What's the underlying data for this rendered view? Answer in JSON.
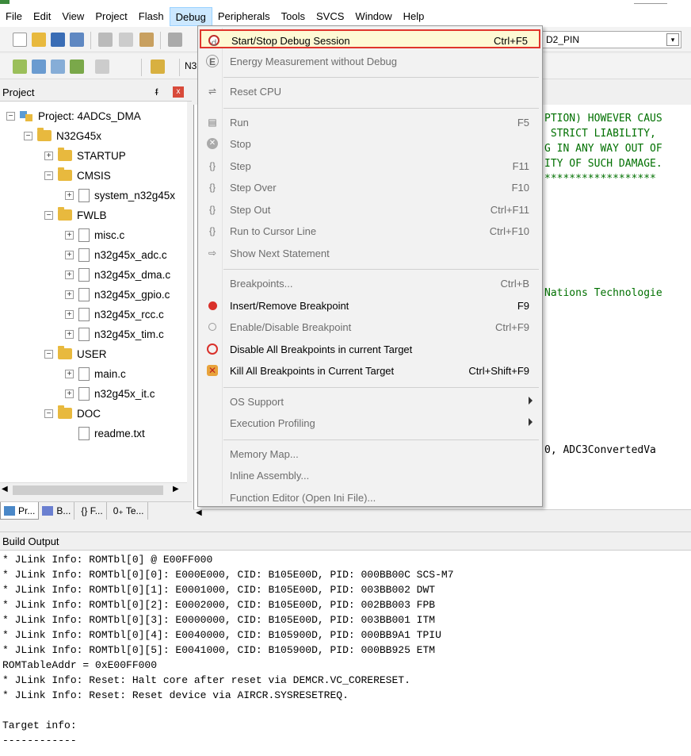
{
  "colors": {
    "highlight_border": "#e0352c",
    "code_green": "#007000",
    "menu_active": "#cce8ff"
  },
  "menubar": [
    "File",
    "Edit",
    "View",
    "Project",
    "Flash",
    "Debug",
    "Peripherals",
    "Tools",
    "SVCS",
    "Window",
    "Help"
  ],
  "toolbar": {
    "target": "D2_PIN",
    "tb2_label": "N3"
  },
  "project_panel": {
    "title": "Project",
    "pin": "ᵮ",
    "close": "x",
    "tree": [
      {
        "label": "Project: 4ADCs_DMA",
        "icon": "project-icon",
        "depth": 0,
        "expander": "−"
      },
      {
        "label": "N32G45x",
        "icon": "folder-icon",
        "depth": 1,
        "expander": "−"
      },
      {
        "label": "STARTUP",
        "icon": "folder-icon",
        "depth": 2,
        "expander": "+"
      },
      {
        "label": "CMSIS",
        "icon": "folder-icon",
        "depth": 2,
        "expander": "−"
      },
      {
        "label": "system_n32g45x",
        "icon": "file-icon",
        "depth": 3,
        "expander": "+"
      },
      {
        "label": "FWLB",
        "icon": "folder-icon",
        "depth": 2,
        "expander": "−"
      },
      {
        "label": "misc.c",
        "icon": "file-icon",
        "depth": 3,
        "expander": "+"
      },
      {
        "label": "n32g45x_adc.c",
        "icon": "file-icon",
        "depth": 3,
        "expander": "+"
      },
      {
        "label": "n32g45x_dma.c",
        "icon": "file-icon",
        "depth": 3,
        "expander": "+"
      },
      {
        "label": "n32g45x_gpio.c",
        "icon": "file-icon",
        "depth": 3,
        "expander": "+"
      },
      {
        "label": "n32g45x_rcc.c",
        "icon": "file-icon",
        "depth": 3,
        "expander": "+"
      },
      {
        "label": "n32g45x_tim.c",
        "icon": "file-icon",
        "depth": 3,
        "expander": "+"
      },
      {
        "label": "USER",
        "icon": "folder-icon",
        "depth": 2,
        "expander": "−"
      },
      {
        "label": "main.c",
        "icon": "file-icon",
        "depth": 3,
        "expander": "+"
      },
      {
        "label": "n32g45x_it.c",
        "icon": "file-icon",
        "depth": 3,
        "expander": "+"
      },
      {
        "label": "DOC",
        "icon": "folder-icon",
        "depth": 2,
        "expander": "−"
      },
      {
        "label": "readme.txt",
        "icon": "file-icon",
        "depth": 3,
        "expander": ""
      }
    ],
    "tabs": [
      "Pr...",
      "B...",
      "{} F...",
      "0₊ Te..."
    ]
  },
  "editor_lines": [
    {
      "text": "PTION) HOWEVER CAUS",
      "color": "green"
    },
    {
      "text": " STRICT LIABILITY,",
      "color": "green"
    },
    {
      "text": "G IN ANY WAY OUT OF",
      "color": "green"
    },
    {
      "text": "ITY OF SUCH DAMAGE.",
      "color": "green"
    },
    {
      "text": "******************",
      "color": "green"
    },
    {
      "text": "Nations Technologie",
      "color": "green"
    },
    {
      "text": "0, ADC3ConvertedVa",
      "color": "black"
    }
  ],
  "debug_menu": [
    {
      "label": "Start/Stop Debug Session",
      "shortcut": "Ctrl+F5",
      "icon": "debug-session-icon",
      "state": "enabled",
      "highlight": true
    },
    {
      "label": "Energy Measurement without Debug",
      "shortcut": "",
      "icon": "energy-icon",
      "state": "disabled"
    },
    {
      "sep": true
    },
    {
      "label": "Reset CPU",
      "shortcut": "",
      "icon": "reset-cpu-icon",
      "state": "disabled"
    },
    {
      "sep": true
    },
    {
      "label": "Run",
      "shortcut": "F5",
      "icon": "run-icon",
      "state": "disabled"
    },
    {
      "label": "Stop",
      "shortcut": "",
      "icon": "stop-icon",
      "state": "disabled"
    },
    {
      "label": "Step",
      "shortcut": "F11",
      "icon": "step-icon",
      "state": "disabled"
    },
    {
      "label": "Step Over",
      "shortcut": "F10",
      "icon": "step-over-icon",
      "state": "disabled"
    },
    {
      "label": "Step Out",
      "shortcut": "Ctrl+F11",
      "icon": "step-out-icon",
      "state": "disabled"
    },
    {
      "label": "Run to Cursor Line",
      "shortcut": "Ctrl+F10",
      "icon": "run-to-cursor-icon",
      "state": "disabled"
    },
    {
      "label": "Show Next Statement",
      "shortcut": "",
      "icon": "next-statement-icon",
      "state": "disabled"
    },
    {
      "sep": true
    },
    {
      "label": "Breakpoints...",
      "shortcut": "Ctrl+B",
      "icon": "",
      "state": "disabled"
    },
    {
      "label": "Insert/Remove Breakpoint",
      "shortcut": "F9",
      "icon": "breakpoint-icon",
      "state": "enabled"
    },
    {
      "label": "Enable/Disable Breakpoint",
      "shortcut": "Ctrl+F9",
      "icon": "enable-breakpoint-icon",
      "state": "disabled"
    },
    {
      "label": "Disable All Breakpoints in current Target",
      "shortcut": "",
      "icon": "disable-breakpoints-icon",
      "state": "enabled"
    },
    {
      "label": "Kill All Breakpoints in Current Target",
      "shortcut": "Ctrl+Shift+F9",
      "icon": "kill-breakpoints-icon",
      "state": "enabled"
    },
    {
      "sep": true
    },
    {
      "label": "OS Support",
      "shortcut": "",
      "icon": "",
      "state": "disabled",
      "submenu": true
    },
    {
      "label": "Execution Profiling",
      "shortcut": "",
      "icon": "",
      "state": "disabled",
      "submenu": true
    },
    {
      "sep": true
    },
    {
      "label": "Memory Map...",
      "shortcut": "",
      "icon": "",
      "state": "disabled"
    },
    {
      "label": "Inline Assembly...",
      "shortcut": "",
      "icon": "",
      "state": "disabled"
    },
    {
      "label": "Function Editor (Open Ini File)...",
      "shortcut": "",
      "icon": "",
      "state": "disabled"
    }
  ],
  "build_output": {
    "title": "Build Output",
    "lines": [
      "* JLink Info: ROMTbl[0] @ E00FF000",
      "* JLink Info: ROMTbl[0][0]: E000E000, CID: B105E00D, PID: 000BB00C SCS-M7",
      "* JLink Info: ROMTbl[0][1]: E0001000, CID: B105E00D, PID: 003BB002 DWT",
      "* JLink Info: ROMTbl[0][2]: E0002000, CID: B105E00D, PID: 002BB003 FPB",
      "* JLink Info: ROMTbl[0][3]: E0000000, CID: B105E00D, PID: 003BB001 ITM",
      "* JLink Info: ROMTbl[0][4]: E0040000, CID: B105900D, PID: 000BB9A1 TPIU",
      "* JLink Info: ROMTbl[0][5]: E0041000, CID: B105900D, PID: 000BB925 ETM",
      "ROMTableAddr = 0xE00FF000",
      "* JLink Info: Reset: Halt core after reset via DEMCR.VC_CORERESET.",
      "* JLink Info: Reset: Reset device via AIRCR.SYSRESETREQ.",
      "",
      "Target info:",
      "------------"
    ]
  }
}
